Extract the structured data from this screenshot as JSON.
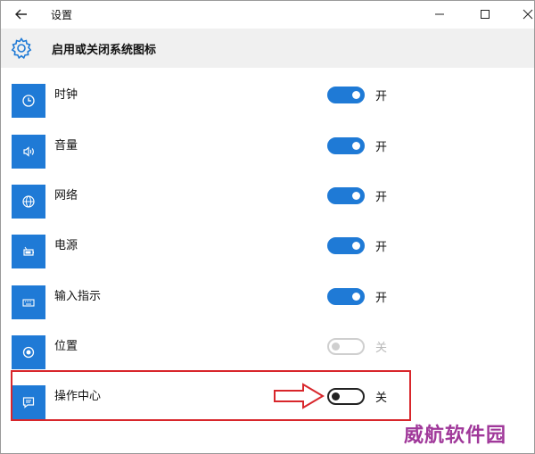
{
  "window": {
    "title": "设置"
  },
  "header": {
    "title": "启用或关闭系统图标"
  },
  "items": [
    {
      "icon": "clock-icon",
      "label": "时钟",
      "state": "on",
      "state_label": "开"
    },
    {
      "icon": "volume-icon",
      "label": "音量",
      "state": "on",
      "state_label": "开"
    },
    {
      "icon": "network-icon",
      "label": "网络",
      "state": "on",
      "state_label": "开"
    },
    {
      "icon": "power-icon",
      "label": "电源",
      "state": "on",
      "state_label": "开"
    },
    {
      "icon": "keyboard-icon",
      "label": "输入指示",
      "state": "on",
      "state_label": "开"
    },
    {
      "icon": "location-icon",
      "label": "位置",
      "state": "disabled",
      "state_label": "关"
    },
    {
      "icon": "action-center-icon",
      "label": "操作中心",
      "state": "off",
      "state_label": "关"
    }
  ],
  "watermark": "威航软件园",
  "colors": {
    "accent": "#1f7ad6",
    "highlight": "#d8262b",
    "watermark": "#a0389a"
  }
}
